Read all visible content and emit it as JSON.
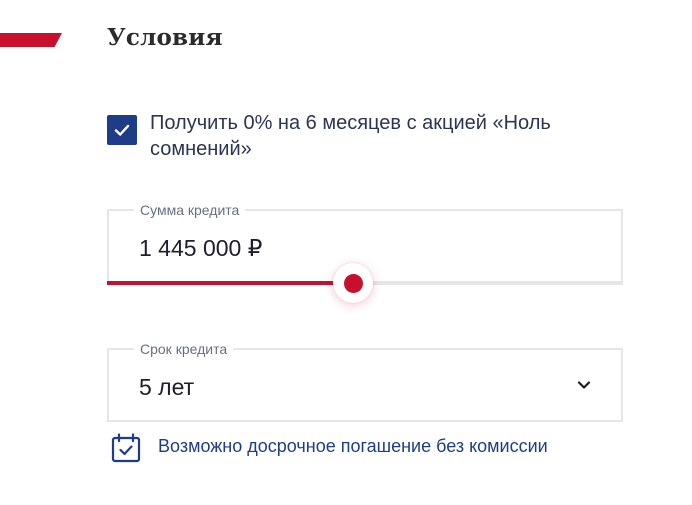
{
  "section": {
    "title": "Условия",
    "accent_color": "#c8102e"
  },
  "promo": {
    "checked": true,
    "label": "Получить 0% на 6 месяцев с акцией «Ноль сомнений»",
    "icon": "checkmark-icon"
  },
  "amount_field": {
    "legend": "Сумма кредита",
    "value": "1 445 000 ₽",
    "slider_fraction": 0.477
  },
  "term_field": {
    "legend": "Срок кредита",
    "value": "5 лет",
    "icon": "chevron-down-icon"
  },
  "info": {
    "icon": "calendar-check-icon",
    "text": "Возможно досрочное погашение без комиссии"
  },
  "colors": {
    "brand_red": "#c8102e",
    "brand_blue": "#1f3c88",
    "border": "#e6e6e6"
  }
}
